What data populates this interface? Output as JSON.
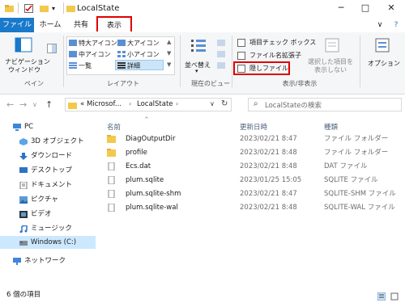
{
  "window": {
    "title": "LocalState"
  },
  "tabs": {
    "file": "ファイル",
    "home": "ホーム",
    "share": "共有",
    "view": "表示",
    "help": "?"
  },
  "ribbon": {
    "pane": {
      "nav_label_1": "ナビゲーション",
      "nav_label_2": "ウィンドウ",
      "group": "ペイン"
    },
    "layout": {
      "xl_icons": "特大アイコン",
      "large_icons": "大アイコン",
      "medium_icons": "中アイコン",
      "small_icons": "小アイコン",
      "list": "一覧",
      "details": "詳細",
      "group": "レイアウト"
    },
    "current_view": {
      "sort_1": "並べ替え",
      "group": "現在のビュー"
    },
    "show_hide": {
      "item_checkboxes": "項目チェック ボックス",
      "file_extensions": "ファイル名拡張子",
      "hidden_items": "隠しファイル",
      "hide_selected_1": "選択した項目を",
      "hide_selected_2": "表示しない",
      "group": "表示/非表示"
    },
    "options": "オプション"
  },
  "address": {
    "path_prefix": "«",
    "crumb1": "Microsof...",
    "crumb2": "LocalState",
    "search_placeholder": "LocalStateの検索"
  },
  "nav": {
    "pc": "PC",
    "objects3d": "3D オブジェクト",
    "downloads": "ダウンロード",
    "desktop": "デスクトップ",
    "documents": "ドキュメント",
    "pictures": "ピクチャ",
    "videos": "ビデオ",
    "music": "ミュージック",
    "windows_c": "Windows (C:)",
    "network": "ネットワーク"
  },
  "columns": {
    "name": "名前",
    "date": "更新日時",
    "type": "種類"
  },
  "files": [
    {
      "name": "DiagOutputDir",
      "date": "2023/02/21 8:47",
      "type": "ファイル フォルダー"
    },
    {
      "name": "profile",
      "date": "2023/02/21 8:48",
      "type": "ファイル フォルダー"
    },
    {
      "name": "Ecs.dat",
      "date": "2023/02/21 8:48",
      "type": "DAT ファイル"
    },
    {
      "name": "plum.sqlite",
      "date": "2023/01/25 15:05",
      "type": "SQLITE ファイル"
    },
    {
      "name": "plum.sqlite-shm",
      "date": "2023/02/21 8:47",
      "type": "SQLITE-SHM ファイル"
    },
    {
      "name": "plum.sqlite-wal",
      "date": "2023/02/21 8:48",
      "type": "SQLITE-WAL ファイル"
    }
  ],
  "status": {
    "count": "6 個の項目"
  },
  "colors": {
    "accent": "#1979ca",
    "highlight": "#e00000",
    "folder": "#f2c94c"
  }
}
